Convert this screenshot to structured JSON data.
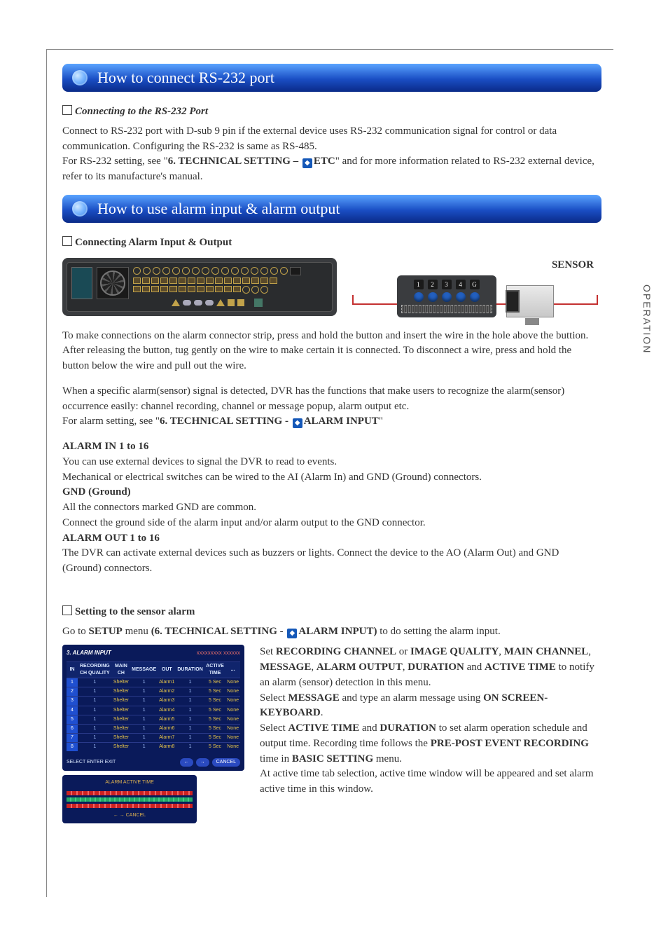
{
  "side_tab": "OPERATION",
  "section1": {
    "heading": "How to connect RS-232 port",
    "sub1": "Connecting to the RS-232 Port",
    "p1": "Connect to RS-232 port with D-sub 9 pin if the external device uses RS-232 communication signal for control or data communication. Configuring the RS-232 is same as RS-485.",
    "p2a": "For RS-232 setting, see \"",
    "p2b": "6. TECHNICAL SETTING – ",
    "p2c": "ETC",
    "p2d": "\" and for more information related to RS-232 external device, refer to its manufacture's manual."
  },
  "section2": {
    "heading": "How to use alarm input & alarm output",
    "sub1": "Connecting Alarm Input & Output",
    "sensor_label": "SENSOR",
    "sensor_nums": [
      "1",
      "2",
      "3",
      "4",
      "G"
    ],
    "p1": "To make connections on the alarm connector strip, press and hold the button and insert the wire in the hole above the buttion. After releasing the button, tug gently on the wire to make certain it is connected. To disconnect a wire, press and hold the button below the wire and pull out the wire.",
    "p2": "When a specific alarm(sensor) signal is detected, DVR has the functions that make users to recognize the alarm(sensor) occurrence easily: channel recording, channel or message popup, alarm output etc.",
    "p3a": "For alarm setting, see \"",
    "p3b": "6. TECHNICAL SETTING - ",
    "p3c": "ALARM INPUT",
    "p3d": "\"",
    "h_ai": "ALARM IN 1 to 16",
    "p_ai1": "You can use external devices to signal the DVR to read to events.",
    "p_ai2": "Mechanical or electrical switches can be wired to the AI (Alarm In) and GND (Ground) connectors.",
    "h_gnd": "GND (Ground)",
    "p_gnd1": "All the connectors marked GND are common.",
    "p_gnd2": "Connect the ground side of the alarm input and/or alarm output to the GND connector.",
    "h_ao": "ALARM OUT 1 to 16",
    "p_ao": "The DVR can activate external devices such as buzzers or lights. Connect the device to the AO (Alarm Out) and GND (Ground) connectors."
  },
  "section3": {
    "sub1": "Setting to the sensor alarm",
    "p1a": "Go to ",
    "p1b": "SETUP",
    "p1c": " menu ",
    "p1d": "(6. TECHNICAL SETTING",
    "p1e": " - ",
    "p1f": "ALARM INPUT)",
    "p1g": " to do setting the alarm input.",
    "r1a": "Set ",
    "r1b": "RECORDING CHANNEL",
    "r1c": " or ",
    "r1d": "IMAGE QUALITY",
    "r1e": ", ",
    "r1f": "MAIN CHANNEL",
    "r1g": ", ",
    "r1h": "MESSAGE",
    "r1i": ", ",
    "r1j": "ALARM OUTPUT",
    "r1k": ", ",
    "r1l": "DURATION",
    "r1m": " and ",
    "r1n": "ACTIVE TIME",
    "r1o": " to notify an alarm (sensor) detection in this menu.",
    "r2a": "Select ",
    "r2b": "MESSAGE",
    "r2c": " and type an alarm message using ",
    "r2d": "ON SCREEN-KEYBOARD",
    "r2e": ".",
    "r3a": "Select ",
    "r3b": "ACTIVE TIME",
    "r3c": " and ",
    "r3d": "DURATION",
    "r3e": " to set alarm operation schedule and output time. Recording time follows the ",
    "r3f": "PRE-POST EVENT RECORDING",
    "r3g": " time in ",
    "r3h": "BASIC SETTING",
    "r3i": " menu.",
    "r4": "At active time tab selection, active time window will be appeared and set alarm active time in this window."
  },
  "alarm_ui": {
    "title": "3. ALARM INPUT",
    "brand": "xxxxxxxxx xxxxxx",
    "columns": [
      "IN",
      "RECORDING CH QUALITY",
      "MAIN CH",
      "MESSAGE",
      "OUT",
      "DURATION",
      "ACTIVE TIME",
      "..."
    ],
    "rows": [
      {
        "n": "1",
        "q": "1",
        "sh": "Shelter",
        "mc": "1",
        "msg": "Alarm1",
        "out": "1",
        "dur": "5 Sec",
        "act": "None"
      },
      {
        "n": "2",
        "q": "1",
        "sh": "Shelter",
        "mc": "1",
        "msg": "Alarm2",
        "out": "1",
        "dur": "5 Sec",
        "act": "None"
      },
      {
        "n": "3",
        "q": "1",
        "sh": "Shelter",
        "mc": "1",
        "msg": "Alarm3",
        "out": "1",
        "dur": "5 Sec",
        "act": "None"
      },
      {
        "n": "4",
        "q": "1",
        "sh": "Shelter",
        "mc": "1",
        "msg": "Alarm4",
        "out": "1",
        "dur": "5 Sec",
        "act": "None"
      },
      {
        "n": "5",
        "q": "1",
        "sh": "Shelter",
        "mc": "1",
        "msg": "Alarm5",
        "out": "1",
        "dur": "5 Sec",
        "act": "None"
      },
      {
        "n": "6",
        "q": "1",
        "sh": "Shelter",
        "mc": "1",
        "msg": "Alarm6",
        "out": "1",
        "dur": "5 Sec",
        "act": "None"
      },
      {
        "n": "7",
        "q": "1",
        "sh": "Shelter",
        "mc": "1",
        "msg": "Alarm7",
        "out": "1",
        "dur": "5 Sec",
        "act": "None"
      },
      {
        "n": "8",
        "q": "1",
        "sh": "Shelter",
        "mc": "1",
        "msg": "Alarm8",
        "out": "1",
        "dur": "5 Sec",
        "act": "None"
      }
    ],
    "footer_left": "SELECT   ENTER   EXIT",
    "footer_btns": [
      "←",
      "→",
      "CANCEL"
    ],
    "active_time_title": "ALARM ACTIVE TIME",
    "active_time_foot": "←  →  CANCEL"
  }
}
